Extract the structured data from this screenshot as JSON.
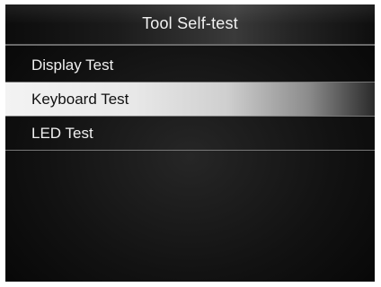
{
  "header": {
    "title": "Tool Self-test"
  },
  "menu": {
    "items": [
      {
        "label": "Display Test",
        "selected": false
      },
      {
        "label": "Keyboard Test",
        "selected": true
      },
      {
        "label": "LED Test",
        "selected": false
      }
    ]
  },
  "colors": {
    "screen_background": "#121212",
    "selection_highlight": "#e8e8e8",
    "text_light": "#f0f0f0",
    "text_dark": "#111111",
    "divider": "#777777"
  }
}
